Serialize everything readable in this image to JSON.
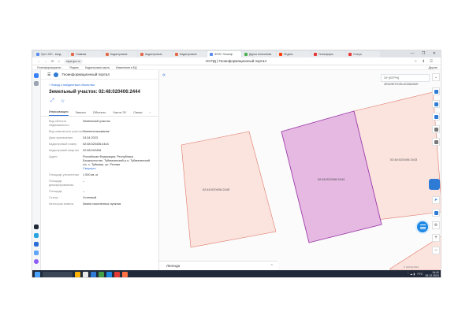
{
  "browser": {
    "tabs": [
      {
        "label": "Про ЧЭС - вход"
      },
      {
        "label": "Главная"
      },
      {
        "label": "Кадастровые"
      },
      {
        "label": "Кадастровые"
      },
      {
        "label": "Кадастровые"
      },
      {
        "label": "ФГИС Геоинф",
        "active": true
      },
      {
        "label": "Дарья Алексеева"
      },
      {
        "label": "Яндекс"
      },
      {
        "label": "Геоинформ"
      },
      {
        "label": "Cтатус"
      }
    ],
    "window_controls": "— ❐ ✕",
    "url": "nspd.gov.ru",
    "page_title": "НСПД | Геоинформационный портал",
    "bookmarks": [
      "Геоинформационн...",
      "Яндекс",
      "Кадастровая карта",
      "Изменения в БД"
    ],
    "bookmarks_right": "Другие"
  },
  "panel": {
    "header": "Геоинформационный портал",
    "back_link": "Назад к найденным объектам",
    "title": "Земельный участок: 02:48:020406:2444",
    "tabs": [
      "Информация",
      "Записи",
      "Объекты",
      "Части ЗУ",
      "Связи"
    ],
    "rows": [
      {
        "label": "Вид объекта недвижимости",
        "value": "Земельный участок"
      },
      {
        "label": "Вид земельного участка",
        "value": "Землепользование"
      },
      {
        "label": "Дата присвоения",
        "value": "24.04.2023"
      },
      {
        "label": "Кадастровый номер",
        "value": "02:48:020406:2444"
      },
      {
        "label": "Кадастровый квартал",
        "value": "02:48:020406"
      },
      {
        "label": "Адрес",
        "value": "Российская Федерация, Республика Башкортостан, Туймазинский р-н, Туймазинский с/с, с. Туймазы, ул. Речная"
      },
      {
        "label": "Площадь уточненная",
        "value": "1 000 кв. м"
      },
      {
        "label": "Площадь декларированная",
        "value": "–"
      },
      {
        "label": "Площадь",
        "value": "–"
      },
      {
        "label": "Статус",
        "value": "Учтенный"
      },
      {
        "label": "Категория земель",
        "value": "Земли населенных пунктов"
      }
    ],
    "more_link": "Свернуть"
  },
  "map": {
    "layer_select": "ЗУ (ЕГРН) ЗЕМЛЕПОЛЬЗОВАНИЕ",
    "parcel_selected_label": "02:48:020406:2444",
    "parcel_left_label": "02:48:020406:2445",
    "parcel_right_label": "02:48:020406:2443",
    "legend": "Легенда",
    "attribution": "© НСПД 2024"
  },
  "taskbar": {
    "time": "14:41",
    "date": "05.12.2024",
    "lang": "РУС"
  },
  "colors": {
    "parcel_fill": "#fbe3de",
    "parcel_stroke": "#e07a6b",
    "selected_fill": "#e6b9e3",
    "selected_stroke": "#9c3aa8",
    "accent": "#2e7bd6",
    "taskbar": "#202a3a"
  }
}
